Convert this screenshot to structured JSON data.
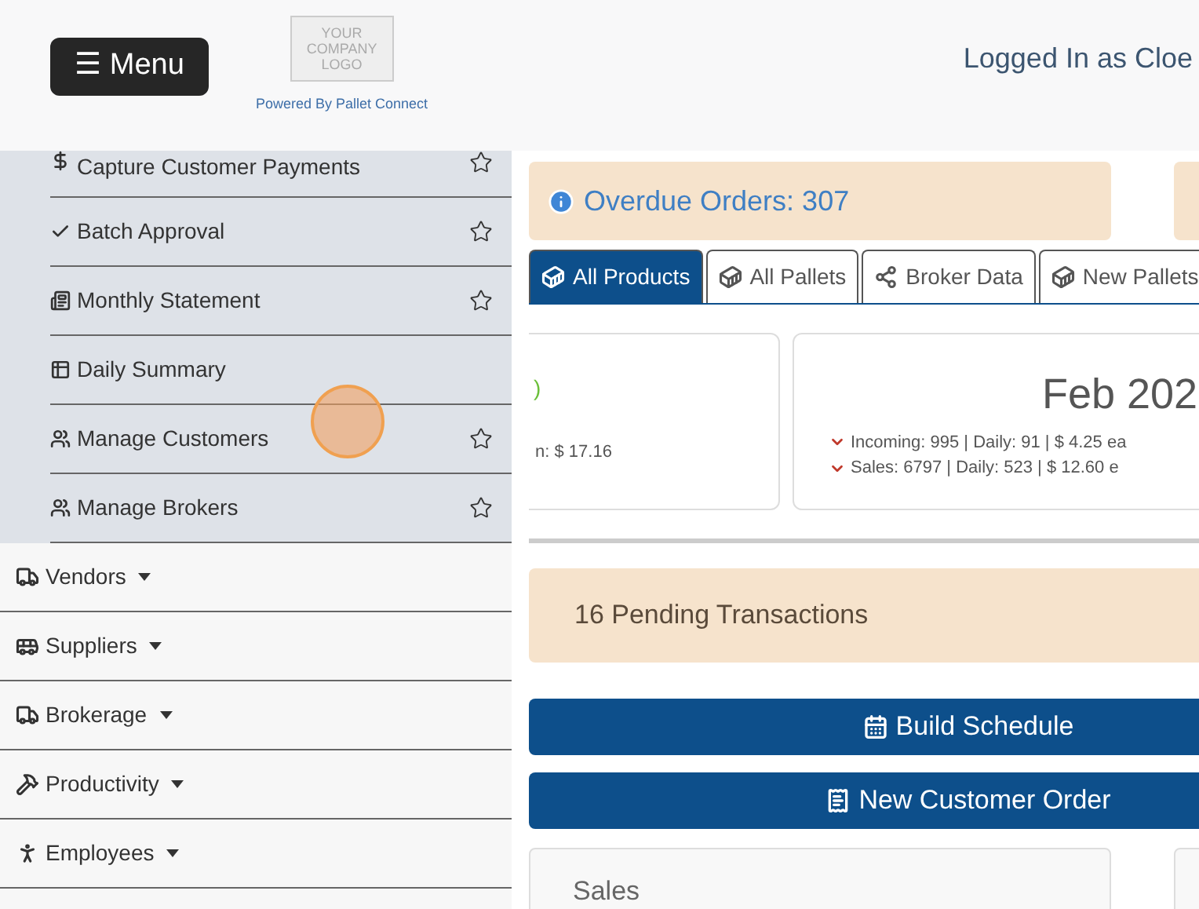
{
  "header": {
    "menu_button": "☰ Menu",
    "logo_lines": [
      "YOUR",
      "COMPANY",
      "LOGO"
    ],
    "powered_by": "Powered By Pallet Connect",
    "user": "Logged In as Cloe"
  },
  "submenu": [
    {
      "label": "Capture Customer Payments",
      "kind": "dollar",
      "favorite": true
    },
    {
      "label": "Batch Approval",
      "kind": "check",
      "favorite": true
    },
    {
      "label": "Monthly Statement",
      "kind": "list",
      "favorite": true
    },
    {
      "label": "Daily Summary",
      "kind": "table",
      "favorite": false
    },
    {
      "label": "Manage Customers",
      "kind": "users",
      "favorite": true
    },
    {
      "label": "Manage Brokers",
      "kind": "users",
      "favorite": true
    }
  ],
  "menu": [
    {
      "label": "Vendors",
      "kind": "truck"
    },
    {
      "label": "Suppliers",
      "kind": "van"
    },
    {
      "label": "Brokerage",
      "kind": "truck"
    },
    {
      "label": "Productivity",
      "kind": "hammer"
    },
    {
      "label": "Employees",
      "kind": "person"
    }
  ],
  "alert": "Overdue Orders: 307",
  "tabs": [
    {
      "label": "All Products",
      "selected": true,
      "kind": "pallet"
    },
    {
      "label": "All Pallets",
      "selected": false,
      "kind": "pallet"
    },
    {
      "label": "Broker Data",
      "selected": false,
      "kind": "share"
    },
    {
      "label": "New Pallets",
      "selected": false,
      "kind": "pallet"
    }
  ],
  "cards": [
    {
      "title": ")",
      "lines": [
        {
          "text": "n: $ 17.16",
          "arrow": false
        }
      ]
    },
    {
      "title": "Feb 202",
      "lines": [
        {
          "text": "Incoming: 995 | Daily: 91 | $ 4.25 ea",
          "arrow": true
        },
        {
          "text": "Sales: 6797 | Daily: 523 | $ 12.60 e",
          "arrow": true
        }
      ]
    }
  ],
  "pending": "16 Pending Transactions",
  "actions": [
    {
      "label": "Build Schedule",
      "kind": "calendar"
    },
    {
      "label": "New Customer Order",
      "kind": "receipt"
    }
  ],
  "panels": [
    "Sales"
  ]
}
